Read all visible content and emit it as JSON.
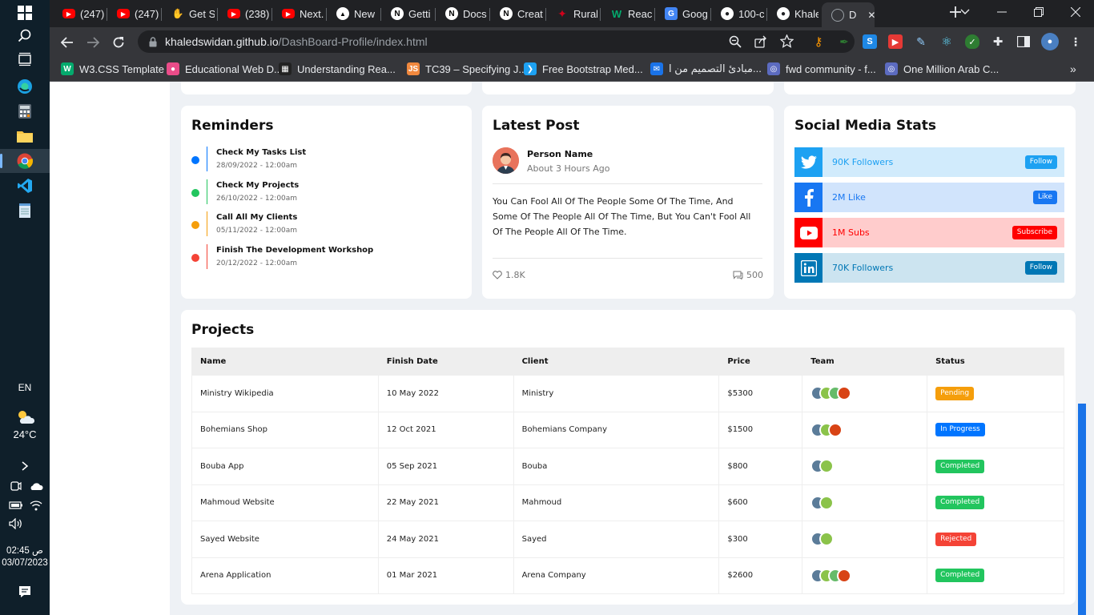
{
  "taskbar": {
    "lang": "EN",
    "temp": "24°C",
    "time": "02:45 ص",
    "date": "03/07/2023"
  },
  "tabs": [
    {
      "label": "(247)",
      "icon": "youtube",
      "color": "#ff0000"
    },
    {
      "label": "(247)",
      "icon": "youtube",
      "color": "#ff0000"
    },
    {
      "label": "Get S",
      "icon": "hand",
      "color": "#f4b400"
    },
    {
      "label": "(238)",
      "icon": "youtube",
      "color": "#ff0000"
    },
    {
      "label": "Next.",
      "icon": "youtube",
      "color": "#ff0000"
    },
    {
      "label": "New",
      "icon": "vercel",
      "color": "#000000"
    },
    {
      "label": "Getti",
      "icon": "next",
      "color": "#000000"
    },
    {
      "label": "Docs",
      "icon": "next",
      "color": "#000000"
    },
    {
      "label": "Creat",
      "icon": "next",
      "color": "#000000"
    },
    {
      "label": "Rural",
      "icon": "maple",
      "color": "#d0021b"
    },
    {
      "label": "React",
      "icon": "w",
      "color": "#04aa6d"
    },
    {
      "label": "Goog",
      "icon": "google-translate",
      "color": "#4285f4"
    },
    {
      "label": "100-c",
      "icon": "github",
      "color": "#ffffff"
    },
    {
      "label": "Khale",
      "icon": "github",
      "color": "#ffffff"
    },
    {
      "label": "D",
      "icon": "globe",
      "color": "#9aa0a6"
    }
  ],
  "omnibox": {
    "host": "khaledswidan.github.io",
    "path": "/DashBoard-Profile/index.html"
  },
  "bookmarks": [
    {
      "label": "W3.CSS Template",
      "color": "#04aa6d",
      "glyph": "W"
    },
    {
      "label": "Educational Web D...",
      "color": "#ea4c89",
      "glyph": "●"
    },
    {
      "label": "Understanding Rea...",
      "color": "#222222",
      "glyph": "▦"
    },
    {
      "label": "TC39 – Specifying J...",
      "color": "#f0883e",
      "glyph": "JS"
    },
    {
      "label": "Free Bootstrap Med...",
      "color": "#1da1f2",
      "glyph": "❯"
    },
    {
      "label": "مبادئ التصميم من ا...",
      "color": "#1a73e8",
      "glyph": "✉"
    },
    {
      "label": "fwd community - f...",
      "color": "#5c6bc0",
      "glyph": "◎"
    },
    {
      "label": "One Million Arab C...",
      "color": "#5c6bc0",
      "glyph": "◎"
    }
  ],
  "reminders": {
    "title": "Reminders",
    "items": [
      {
        "title": "Check My Tasks List",
        "date": "28/09/2022 - 12:00am",
        "color": "#0075ff"
      },
      {
        "title": "Check My Projects",
        "date": "26/10/2022 - 12:00am",
        "color": "#22c55e"
      },
      {
        "title": "Call All My Clients",
        "date": "05/11/2022 - 12:00am",
        "color": "#f59e0b"
      },
      {
        "title": "Finish The Development Workshop",
        "date": "20/12/2022 - 12:00am",
        "color": "#f44336"
      }
    ]
  },
  "post": {
    "title": "Latest Post",
    "name": "Person Name",
    "time": "About 3 Hours Ago",
    "body": "You Can Fool All Of The People Some Of The Time, And Some Of The People All Of The Time, But You Can't Fool All Of The People All Of The Time.",
    "likes": "1.8K",
    "comments": "500"
  },
  "social": {
    "title": "Social Media Stats",
    "items": [
      {
        "icon": "twitter-icon",
        "text": "90K Followers",
        "button": "Follow",
        "main": "#1da1f2",
        "bg": "#d1ebfc"
      },
      {
        "icon": "facebook-icon",
        "text": "2M Like",
        "button": "Like",
        "main": "#1877f2",
        "bg": "#d1e4fc"
      },
      {
        "icon": "youtube-icon",
        "text": "1M Subs",
        "button": "Subscribe",
        "main": "#ff0000",
        "bg": "#ffcccc"
      },
      {
        "icon": "linkedin-icon",
        "text": "70K Followers",
        "button": "Follow",
        "main": "#0077b5",
        "bg": "#cce4f0"
      }
    ]
  },
  "projects": {
    "title": "Projects",
    "columns": [
      "Name",
      "Finish Date",
      "Client",
      "Price",
      "Team",
      "Status"
    ],
    "rows": [
      {
        "name": "Ministry Wikipedia",
        "date": "10 May 2022",
        "client": "Ministry",
        "price": "$5300",
        "team": 4,
        "status": "Pending",
        "status_color": "#f59e0b"
      },
      {
        "name": "Bohemians Shop",
        "date": "12 Oct 2021",
        "client": "Bohemians Company",
        "price": "$1500",
        "team": 3,
        "status": "In Progress",
        "status_color": "#0075ff"
      },
      {
        "name": "Bouba App",
        "date": "05 Sep 2021",
        "client": "Bouba",
        "price": "$800",
        "team": 2,
        "status": "Completed",
        "status_color": "#22c55e"
      },
      {
        "name": "Mahmoud Website",
        "date": "22 May 2021",
        "client": "Mahmoud",
        "price": "$600",
        "team": 2,
        "status": "Completed",
        "status_color": "#22c55e"
      },
      {
        "name": "Sayed Website",
        "date": "24 May 2021",
        "client": "Sayed",
        "price": "$300",
        "team": 2,
        "status": "Rejected",
        "status_color": "#f44336"
      },
      {
        "name": "Arena Application",
        "date": "01 Mar 2021",
        "client": "Arena Company",
        "price": "$2600",
        "team": 4,
        "status": "Completed",
        "status_color": "#22c55e"
      }
    ]
  }
}
